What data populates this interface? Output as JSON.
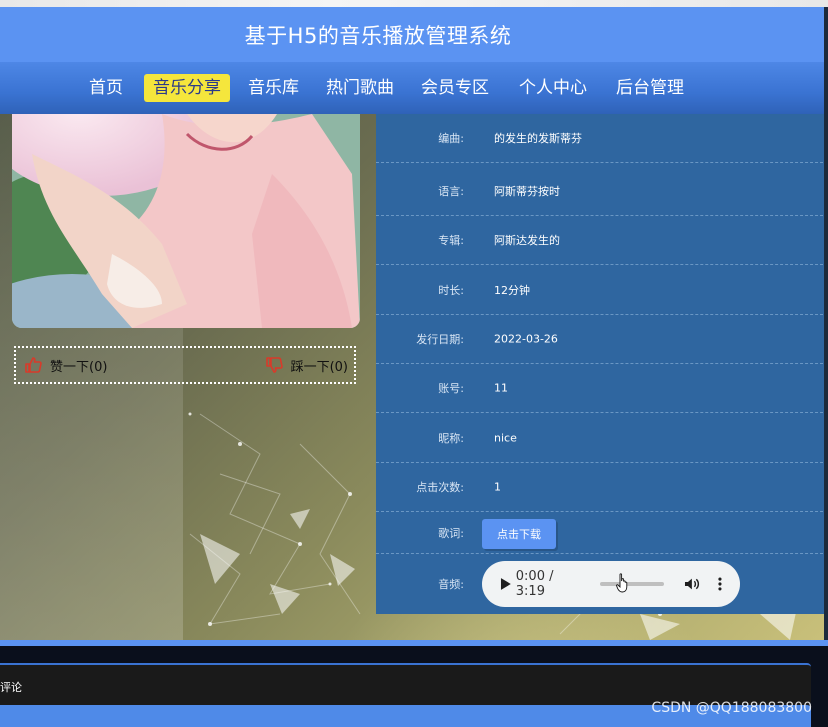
{
  "site": {
    "title": "基于H5的音乐播放管理系统"
  },
  "nav": {
    "items": [
      {
        "label": "首页",
        "active": false
      },
      {
        "label": "音乐分享",
        "active": true
      },
      {
        "label": "音乐库",
        "active": false
      },
      {
        "label": "热门歌曲",
        "active": false
      },
      {
        "label": "会员专区",
        "active": false
      },
      {
        "label": "个人中心",
        "active": false
      },
      {
        "label": "后台管理",
        "active": false
      }
    ]
  },
  "vote": {
    "like_label": "赞一下(0)",
    "dislike_label": "踩一下(0)",
    "like_icon": "thumbs-up-icon",
    "dislike_icon": "thumbs-down-icon"
  },
  "details": {
    "rows": [
      {
        "label": "编曲:",
        "value": "的发生的发斯蒂芬"
      },
      {
        "label": "语言:",
        "value": "阿斯蒂芬按时"
      },
      {
        "label": "专辑:",
        "value": "阿斯达发生的"
      },
      {
        "label": "时长:",
        "value": "12分钟"
      },
      {
        "label": "发行日期:",
        "value": "2022-03-26"
      },
      {
        "label": "账号:",
        "value": "11"
      },
      {
        "label": "昵称:",
        "value": "nice"
      },
      {
        "label": "点击次数:",
        "value": "1"
      }
    ],
    "lyrics_label": "歌词:",
    "download_button": "点击下载",
    "audio_label": "音频:"
  },
  "audio_player": {
    "time_display": "0:00 / 3:19",
    "progress": 0,
    "icons": [
      "play-icon",
      "volume-icon",
      "more-options-icon"
    ]
  },
  "comments": {
    "label": "评论"
  },
  "watermark": "CSDN @QQ188083800",
  "colors": {
    "primary": "#5b93f2",
    "nav_active_bg": "#f5e63c",
    "panel_bg": "#2f66a0",
    "like_icon": "#d83a2a"
  }
}
